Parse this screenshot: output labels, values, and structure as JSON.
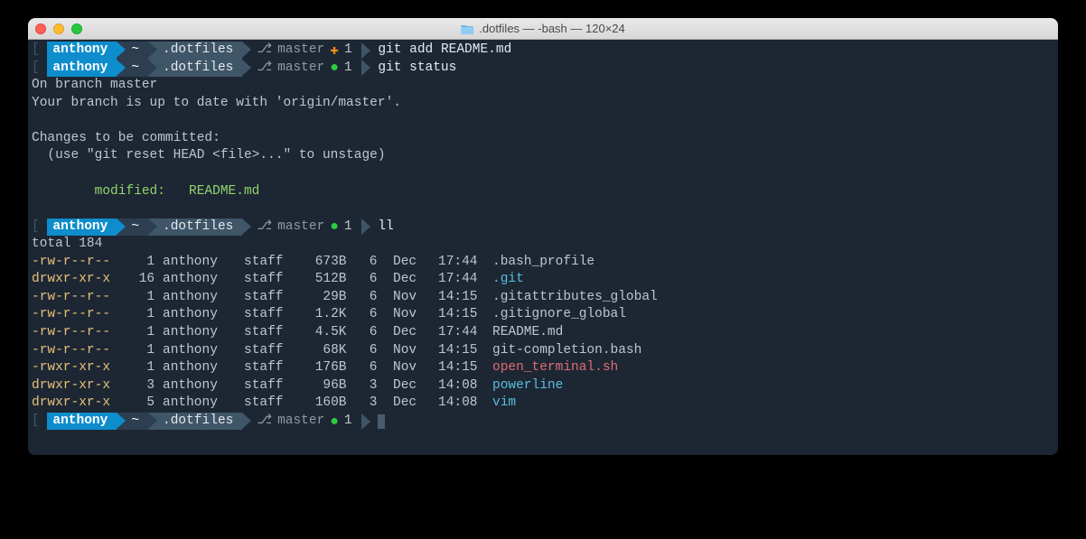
{
  "window": {
    "title": ".dotfiles — -bash — 120×24"
  },
  "prompts": {
    "user": "anthony",
    "home": "~",
    "dir": ".dotfiles",
    "branch": "master",
    "staged_count": "1",
    "arrow": "❯"
  },
  "commands": {
    "c1": "git add README.md",
    "c2": "git status",
    "c3": "ll",
    "c4": ""
  },
  "git_status": {
    "l1": "On branch master",
    "l2": "Your branch is up to date with 'origin/master'.",
    "l3": "Changes to be committed:",
    "l4": "  (use \"git reset HEAD <file>...\" to unstage)",
    "l5": "        modified:   README.md"
  },
  "ls": {
    "total": "total 184",
    "rows": [
      {
        "perm": "-rw-r--r--",
        "links": "1",
        "owner": "anthony",
        "group": "staff",
        "size": "673B",
        "day": "6",
        "mon": "Dec",
        "time": "17:44",
        "name": ".bash_profile",
        "cls": ""
      },
      {
        "perm": "drwxr-xr-x",
        "links": "16",
        "owner": "anthony",
        "group": "staff",
        "size": "512B",
        "day": "6",
        "mon": "Dec",
        "time": "17:44",
        "name": ".git",
        "cls": "blue"
      },
      {
        "perm": "-rw-r--r--",
        "links": "1",
        "owner": "anthony",
        "group": "staff",
        "size": "29B",
        "day": "6",
        "mon": "Nov",
        "time": "14:15",
        "name": ".gitattributes_global",
        "cls": ""
      },
      {
        "perm": "-rw-r--r--",
        "links": "1",
        "owner": "anthony",
        "group": "staff",
        "size": "1.2K",
        "day": "6",
        "mon": "Nov",
        "time": "14:15",
        "name": ".gitignore_global",
        "cls": ""
      },
      {
        "perm": "-rw-r--r--",
        "links": "1",
        "owner": "anthony",
        "group": "staff",
        "size": "4.5K",
        "day": "6",
        "mon": "Dec",
        "time": "17:44",
        "name": "README.md",
        "cls": ""
      },
      {
        "perm": "-rw-r--r--",
        "links": "1",
        "owner": "anthony",
        "group": "staff",
        "size": "68K",
        "day": "6",
        "mon": "Nov",
        "time": "14:15",
        "name": "git-completion.bash",
        "cls": ""
      },
      {
        "perm": "-rwxr-xr-x",
        "links": "1",
        "owner": "anthony",
        "group": "staff",
        "size": "176B",
        "day": "6",
        "mon": "Nov",
        "time": "14:15",
        "name": "open_terminal.sh",
        "cls": "red"
      },
      {
        "perm": "drwxr-xr-x",
        "links": "3",
        "owner": "anthony",
        "group": "staff",
        "size": "96B",
        "day": "3",
        "mon": "Dec",
        "time": "14:08",
        "name": "powerline",
        "cls": "blue"
      },
      {
        "perm": "drwxr-xr-x",
        "links": "5",
        "owner": "anthony",
        "group": "staff",
        "size": "160B",
        "day": "3",
        "mon": "Dec",
        "time": "14:08",
        "name": "vim",
        "cls": "blue"
      }
    ]
  }
}
